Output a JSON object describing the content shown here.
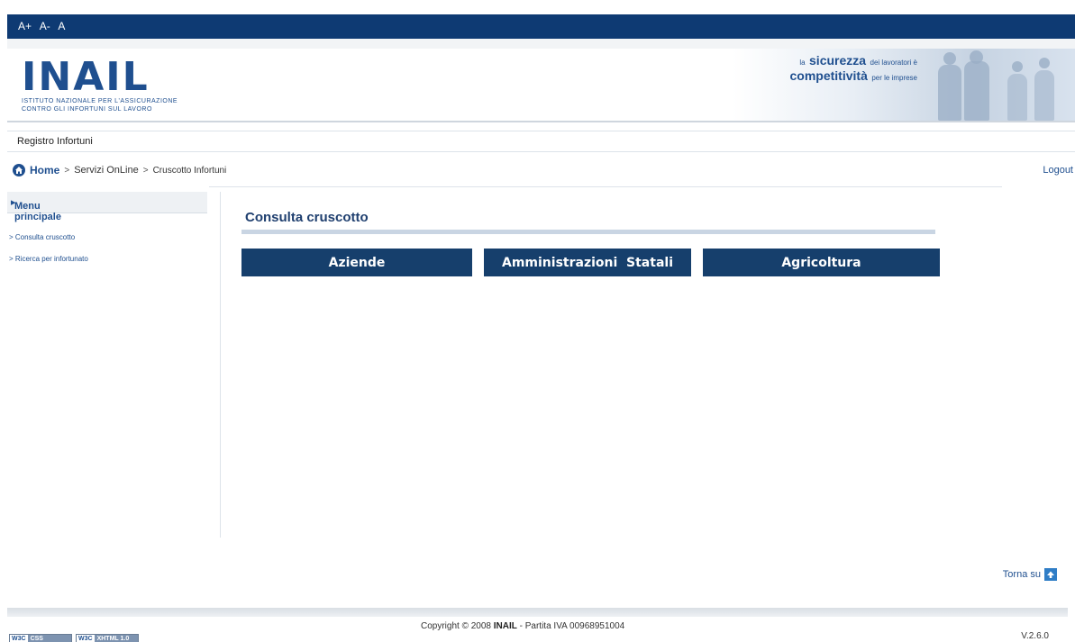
{
  "font_controls": [
    "A+",
    "A-",
    "A"
  ],
  "logo": {
    "word": "INAIL",
    "subtitle_1": "ISTITUTO NAZIONALE PER L'ASSICURAZIONE",
    "subtitle_2": "CONTRO GLI INFORTUNI SUL LAVORO"
  },
  "slogan": {
    "la": "la",
    "sicurezza": "sicurezza",
    "dei_lavoratori": "dei lavoratori è",
    "competitivita": "competitività",
    "per_le_imprese": "per le imprese"
  },
  "app_title": "Registro Infortuni",
  "breadcrumb": {
    "home": "Home",
    "sep": ">",
    "servizi": "Servizi OnLine",
    "current": "Cruscotto Infortuni"
  },
  "logout": "Logout",
  "sidebar": {
    "header": "Menu principale",
    "items": [
      "> Consulta cruscotto",
      "> Ricerca per infortunato"
    ]
  },
  "content": {
    "title": "Consulta cruscotto",
    "buttons": [
      "Aziende",
      "Amministrazioni  Statali",
      "Agricoltura"
    ]
  },
  "footer": {
    "back_to_top": "Torna su",
    "copyright_prefix": "Copyright © 2008",
    "copyright_brand": "INAIL",
    "copyright_suffix": "- Partita IVA 00968951004",
    "version": "V.2.6.0",
    "badge_css_a": "W3C",
    "badge_css_b": "CSS",
    "badge_xhtml_a": "W3C",
    "badge_xhtml_b": "XHTML 1.0"
  },
  "colors": {
    "brand_blue": "#0e3a73",
    "button_blue": "#163f6c",
    "link_blue": "#1f4f8f"
  }
}
